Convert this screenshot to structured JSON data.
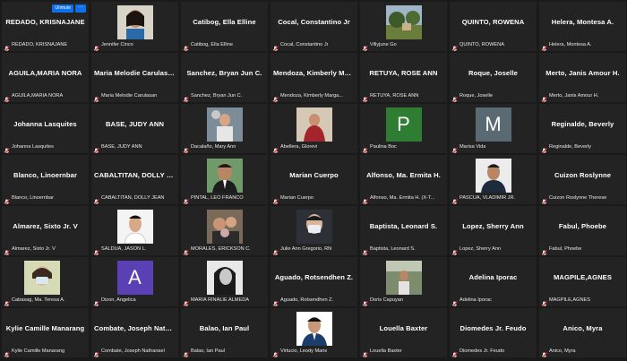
{
  "controls": {
    "unmute_label": "Unmute",
    "more_label": "···"
  },
  "tiles": [
    {
      "name": "REDADO, KRISNAJANE",
      "caption": "REDADO, KRISNAJANE",
      "show_unmute": true
    },
    {
      "caption": "Jennifer Cinco",
      "photo": "p1"
    },
    {
      "name": "Catibog, Ella Elline",
      "caption": "Catibog, Ella Elline"
    },
    {
      "name": "Cocal, Constantino Jr",
      "caption": "Cocal, Constantino Jr"
    },
    {
      "caption": "Villyjune Go",
      "photo": "p2"
    },
    {
      "name": "QUINTO, ROWENA",
      "caption": "QUINTO, ROWENA"
    },
    {
      "name": "Helera, Montesa A.",
      "caption": "Helera, Montesa A."
    },
    {
      "name": "AGUILA,MARIA NORA",
      "caption": "AGUILA,MARIA NORA"
    },
    {
      "name": "Maria Melodie Carulasan",
      "caption": "Maria Melodie Carulasan"
    },
    {
      "name": "Sanchez, Bryan Jun C.",
      "caption": "Sanchez, Bryan Jun C."
    },
    {
      "name": "Mendoza, Kimberly Margarette",
      "caption": "Mendoza, Kimberly Marga..."
    },
    {
      "name": "RETUYA, ROSE ANN",
      "caption": "RETUYA, ROSE ANN"
    },
    {
      "name": "Roque, Joselle",
      "caption": "Roque, Joselle"
    },
    {
      "name": "Merto, Janis Amour H.",
      "caption": "Merto, Janis Amour H."
    },
    {
      "name": "Johanna Lasquites",
      "caption": "Johanna Lasquites"
    },
    {
      "name": "BASE, JUDY ANN",
      "caption": "BASE, JUDY ANN"
    },
    {
      "caption": "Dacalaño, Mary Ann",
      "photo": "p3"
    },
    {
      "caption": "Abellera, Glorevi",
      "photo": "p4"
    },
    {
      "caption": "Paulina Boc",
      "letter": "P",
      "letter_bg": "#2f7d33"
    },
    {
      "caption": "Marisa Vida",
      "letter": "M",
      "letter_bg": "#5a6a72"
    },
    {
      "name": "Reginalde, Beverly",
      "caption": "Reginalde, Beverly"
    },
    {
      "name": "Blanco, Linoernbar",
      "caption": "Blanco, Linoernbar"
    },
    {
      "name": "CABALTITAN, DOLLY JEAN",
      "caption": "CABALTITAN, DOLLY JEAN"
    },
    {
      "caption": "PINTAL, LEO FRANCO",
      "photo": "p5"
    },
    {
      "name": "Marian Cuerpo",
      "caption": "Marian Cuerpo"
    },
    {
      "name": "Alfonso, Ma. Ermita H.",
      "caption": "Alfonso, Ma. Ermita H. (X-T..."
    },
    {
      "caption": "PASCUA, VLADIMIR JR.",
      "photo": "p6"
    },
    {
      "name": "Cuizon Roslynne",
      "caption": "Cuizon Roslynne Therese"
    },
    {
      "name": "Almarez, Sixto Jr. V",
      "caption": "Almarez, Sixto Jr. V"
    },
    {
      "caption": "SALDUA, JASON L.",
      "photo": "p7"
    },
    {
      "caption": "MORALES, ERICKSON C.",
      "photo": "p8"
    },
    {
      "caption": "Julie Ann Gregorio, RN",
      "photo": "p9"
    },
    {
      "name": "Baptista, Leonard S.",
      "caption": "Baptista, Leonard S."
    },
    {
      "name": "Lopez, Sherry Ann",
      "caption": "Lopez, Sherry Ann"
    },
    {
      "name": "Fabul, Phoebe",
      "caption": "Fabul, Phoebe"
    },
    {
      "caption": "Cabasag, Ma. Teresa A.",
      "photo": "p10",
      "wide": true
    },
    {
      "caption": "Dizon, Angelica",
      "letter": "A",
      "letter_bg": "#5b3fb5"
    },
    {
      "caption": "MARIA RINALIE ALMEDA",
      "photo": "p11"
    },
    {
      "name": "Aguado, Rotsendhen Z.",
      "caption": "Aguado, Rotsendhen Z."
    },
    {
      "caption": "Doris Capuyan",
      "photo": "p12"
    },
    {
      "name": "Adelina Iporac",
      "caption": "Adelina Iporac"
    },
    {
      "name": "MAGPILE,AGNES",
      "caption": "MAGPILE,AGNES"
    },
    {
      "name": "Kylie Camille Manarang",
      "caption": "Kylie Camille Manarang"
    },
    {
      "name": "Combate, Joseph Nathanael",
      "caption": "Combate, Joseph Nathanael"
    },
    {
      "name": "Balao, Ian Paul",
      "caption": "Balao, Ian Paul"
    },
    {
      "caption": "Virtucio, Leody Marie",
      "photo": "p13"
    },
    {
      "name": "Louella Baxter",
      "caption": "Louella Baxter"
    },
    {
      "name": "Diomedes Jr. Feudo",
      "caption": "Diomedes Jr. Feudo"
    },
    {
      "name": "Anico, Myra",
      "caption": "Anico, Myra"
    }
  ]
}
